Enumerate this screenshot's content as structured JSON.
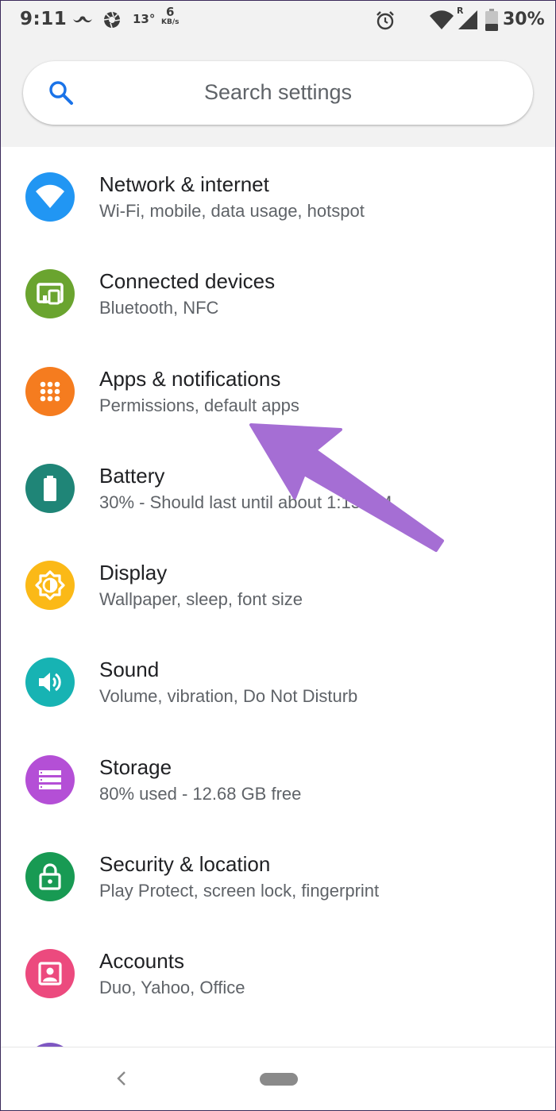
{
  "status_bar": {
    "time": "9:11",
    "temperature": "13°",
    "net_speed_value": "6",
    "net_speed_unit": "KB/s",
    "battery_percent": "30%",
    "icons": [
      "mustache-icon",
      "camera-shutter-icon",
      "alarm-icon",
      "wifi-icon",
      "signal-icon",
      "battery-icon"
    ]
  },
  "search": {
    "placeholder": "Search settings",
    "icon": "search-icon"
  },
  "settings": [
    {
      "id": "network",
      "title": "Network & internet",
      "subtitle": "Wi-Fi, mobile, data usage, hotspot",
      "icon": "wifi-icon",
      "color": "#2196F3"
    },
    {
      "id": "connected-devices",
      "title": "Connected devices",
      "subtitle": "Bluetooth, NFC",
      "icon": "devices-icon",
      "color": "#6aa42f"
    },
    {
      "id": "apps",
      "title": "Apps & notifications",
      "subtitle": "Permissions, default apps",
      "icon": "apps-grid-icon",
      "color": "#f57c1f"
    },
    {
      "id": "battery",
      "title": "Battery",
      "subtitle": "30% - Should last until about 1:15 PM",
      "icon": "battery-icon",
      "color": "#1f8577"
    },
    {
      "id": "display",
      "title": "Display",
      "subtitle": "Wallpaper, sleep, font size",
      "icon": "brightness-icon",
      "color": "#fbb917"
    },
    {
      "id": "sound",
      "title": "Sound",
      "subtitle": "Volume, vibration, Do Not Disturb",
      "icon": "volume-icon",
      "color": "#17b3b3"
    },
    {
      "id": "storage",
      "title": "Storage",
      "subtitle": "80% used - 12.68 GB free",
      "icon": "storage-icon",
      "color": "#b44fd6"
    },
    {
      "id": "security",
      "title": "Security & location",
      "subtitle": "Play Protect, screen lock, fingerprint",
      "icon": "lock-icon",
      "color": "#189a53"
    },
    {
      "id": "accounts",
      "title": "Accounts",
      "subtitle": "Duo, Yahoo, Office",
      "icon": "account-icon",
      "color": "#ec4a7e"
    }
  ],
  "annotation": {
    "icon": "annotation-arrow-icon",
    "color": "#a56ed4"
  },
  "nav_bar": {
    "back_icon": "back-icon",
    "home_icon": "home-pill-icon"
  }
}
